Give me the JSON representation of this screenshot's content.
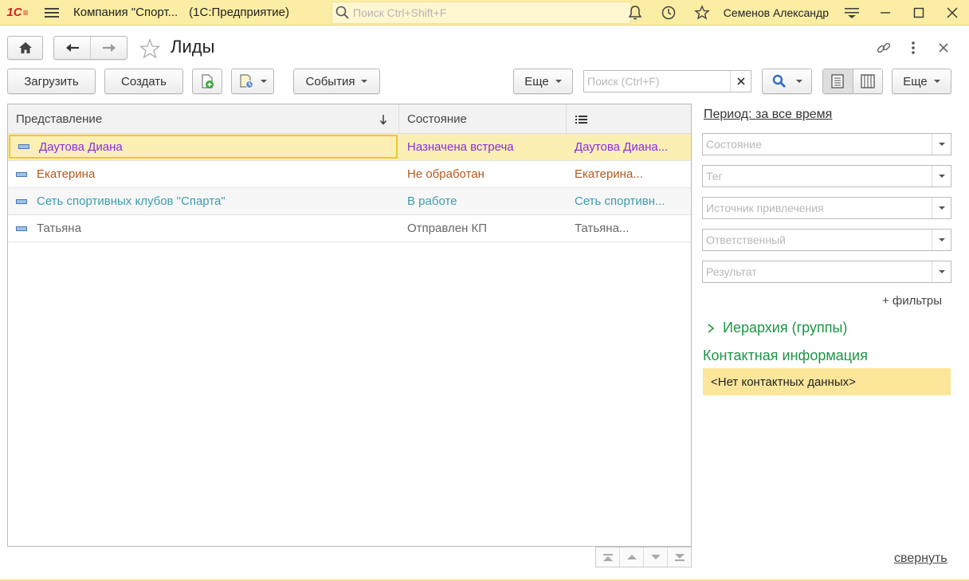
{
  "titlebar": {
    "logo": "1С",
    "app_title": "Компания \"Спорт...",
    "app_subtitle": "(1С:Предприятие)",
    "search_placeholder": "Поиск Ctrl+Shift+F",
    "user_name": "Семенов Александр"
  },
  "header": {
    "title": "Лиды"
  },
  "toolbar": {
    "load_label": "Загрузить",
    "create_label": "Создать",
    "events_label": "События",
    "more_label": "Еще",
    "search_placeholder": "Поиск (Ctrl+F)",
    "more2_label": "Еще"
  },
  "table": {
    "columns": [
      "Представление",
      "Состояние"
    ],
    "rows": [
      {
        "name": "Даутова Диана",
        "status": "Назначена встреча",
        "extra": "Даутова Диана...",
        "color": "#8a2be2"
      },
      {
        "name": "Екатерина",
        "status": "Не обработан",
        "extra": "Екатерина...",
        "color": "#b35a1f"
      },
      {
        "name": "Сеть спортивных клубов \"Спарта\"",
        "status": "В работе",
        "extra": "Сеть спортивн...",
        "color": "#3a9eae"
      },
      {
        "name": "Татьяна",
        "status": "Отправлен КП",
        "extra": "Татьяна...",
        "color": "#666666"
      }
    ]
  },
  "sidebar": {
    "period_link": "Период: за все время",
    "filters": [
      {
        "placeholder": "Состояние"
      },
      {
        "placeholder": "Тег"
      },
      {
        "placeholder": "Источник привлечения"
      },
      {
        "placeholder": "Ответственный"
      },
      {
        "placeholder": "Результат"
      }
    ],
    "add_filters": "+ фильтры",
    "hierarchy": "Иерархия (группы)",
    "contact_title": "Контактная информация",
    "contact_empty": "<Нет контактных данных>",
    "collapse": "свернуть"
  },
  "colors": {
    "titlebar_bg": "#fbeda3",
    "selected_row": "#fcefb4",
    "accent_green": "#1b9645",
    "brand_red": "#d61f26"
  }
}
